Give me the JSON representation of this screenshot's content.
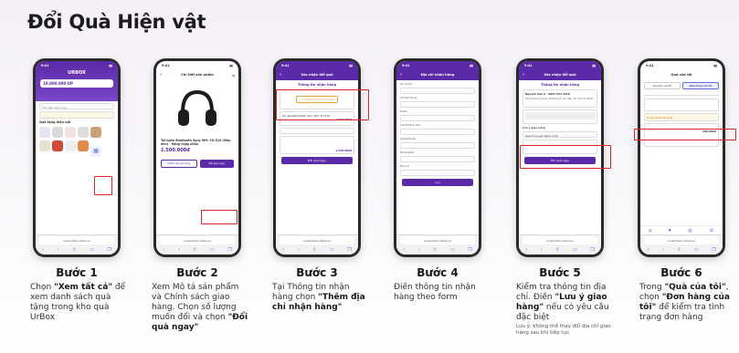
{
  "title": "Đổi Quà Hiện vật",
  "phones": {
    "p1": {
      "time": "9:41",
      "brand": "URBOX",
      "points": "10.000.000 UP",
      "search": "Tìm kiếm Sony hay...",
      "section": "Quà tặng hiện vật",
      "url": "urcard-link.urbox.vn"
    },
    "p2": {
      "time": "9:41",
      "header": "Chi tiết sản phẩm",
      "product": "Tai nghe Bluetooth Sony WH- CH 510 (Màu đen) - Hàng nhập khẩu",
      "price": "1.500.000đ",
      "btn_cart": "Thêm vào giỏ hàng",
      "btn_redeem": "Đổi quà ngay",
      "url": "urcard-link.urbox.vn"
    },
    "p3": {
      "time": "9:41",
      "header": "Xác nhận đổi quà",
      "section": "Thông tin nhận hàng",
      "add_address": "+ Thêm địa chỉ nhận hàng",
      "item": "Tai nghe Bluetooth Sony WH- CH 510",
      "price": "1.500.000đ",
      "total": "1.520.000đ",
      "btn": "Đổi quà ngay",
      "url": "urcard-link.urbox.vn"
    },
    "p4": {
      "time": "9:41",
      "header": "Địa chỉ nhận hàng",
      "fields": [
        "Họ và tên",
        "Số điện thoại",
        "Email",
        "Tỉnh/Thành phố",
        "Quận/Huyện",
        "Phường/Xã",
        "Địa chỉ"
      ],
      "btn": "Lưu",
      "url": "urcard-link.urbox.vn"
    },
    "p5": {
      "time": "9:41",
      "header": "Xác nhận đổi quà",
      "section": "Thông tin nhận hàng",
      "name": "Nguyễn Văn A - 0987 654 3210",
      "address": "691 Quang Trung, Phường 8, Gò Vấp, TP. Hồ Chí Minh",
      "note_label": "Lưu ý giao hàng",
      "note_text": "Giao trong giờ hành chính",
      "btn": "Đổi quà ngay",
      "url": "urcard-link.urbox.vn"
    },
    "p6": {
      "time": "9:41",
      "header": "Quà của tôi",
      "tab1": "Voucher của tôi",
      "tab2": "Đơn hàng của tôi",
      "status": "Đang chuẩn bị hàng",
      "price": "260.000đ",
      "url": "urcard-link.urbox.vn"
    }
  },
  "steps": [
    {
      "title": "Bước 1",
      "d1": "Chọn ",
      "b1": "\"Xem tất cả\"",
      "d2": " để xem danh sách quà tặng trong kho quà UrBox",
      "b2": "",
      "d3": ""
    },
    {
      "title": "Bước 2",
      "d1": "Xem Mô tả sản phẩm và Chính sách giao hàng. Chọn số lượng muốn đổi và chọn ",
      "b1": "\"Đổi quà ngay\"",
      "d2": "",
      "b2": "",
      "d3": ""
    },
    {
      "title": "Bước 3",
      "d1": "Tại Thông tin nhận hàng chọn ",
      "b1": "\"Thêm địa chỉ nhận hàng\"",
      "d2": "",
      "b2": "",
      "d3": ""
    },
    {
      "title": "Bước 4",
      "d1": "Điền thông tin nhận hàng theo form",
      "b1": "",
      "d2": "",
      "b2": "",
      "d3": ""
    },
    {
      "title": "Bước 5",
      "d1": "Kiểm tra thông tin địa chỉ. Điền ",
      "b1": "\"Lưu ý giao hàng\"",
      "d2": " nếu có yêu cầu đặc biệt",
      "b2": "",
      "d3": "",
      "note": "Lưu ý: không thể thay đổi địa chỉ giao hàng sau khi tiếp tục"
    },
    {
      "title": "Bước 6",
      "d1": "Trong ",
      "b1": "\"Quà của tôi\"",
      "d2": ", chọn ",
      "b2": "\"Đơn hàng của tôi\"",
      "d3": " để kiểm tra tình trạng đơn hàng"
    }
  ]
}
